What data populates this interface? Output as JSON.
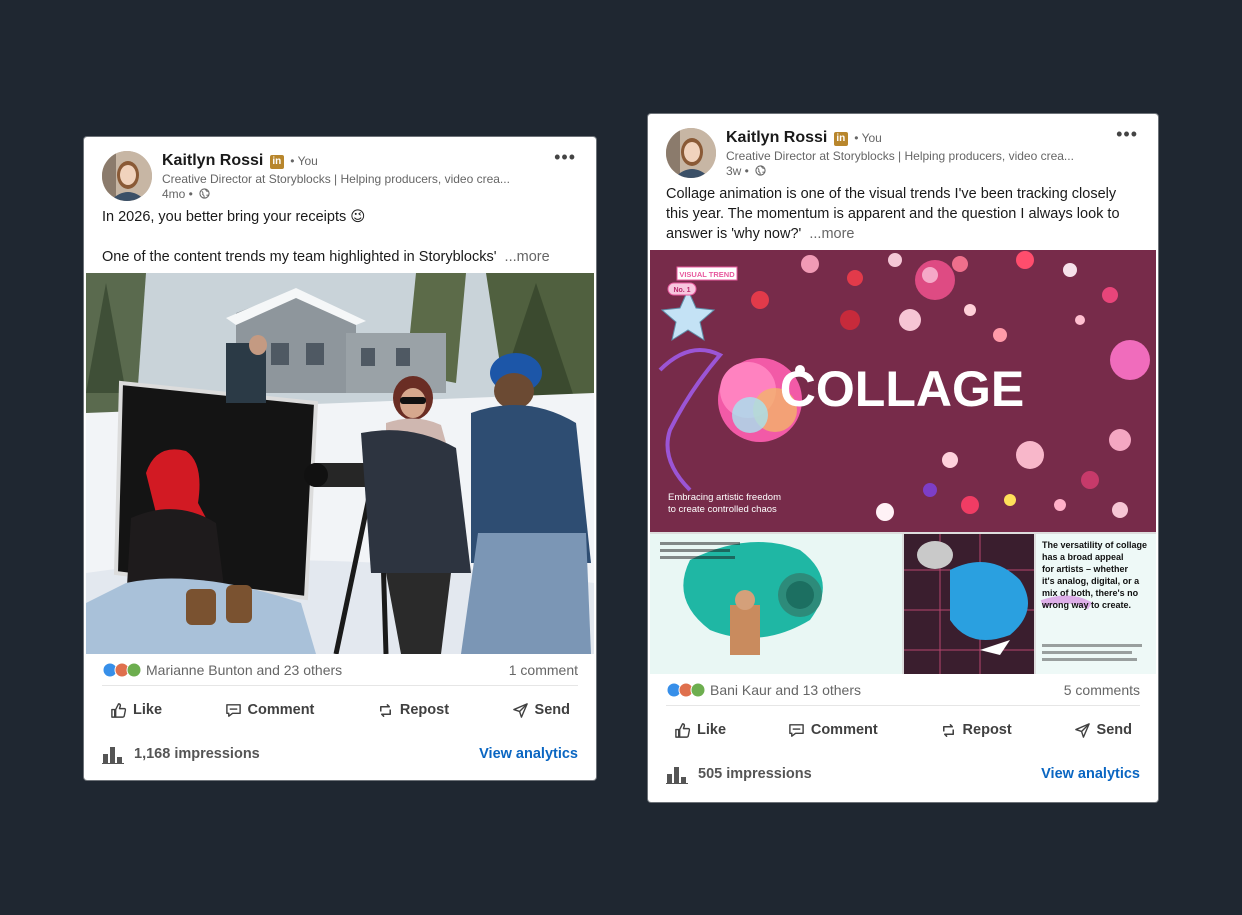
{
  "posts": [
    {
      "author": "Kaitlyn Rossi",
      "badge": "in",
      "you_label": "• You",
      "headline": "Creative Director at Storyblocks | Helping producers, video crea...",
      "time": "4mo •",
      "text_line1": "In 2026, you better bring your receipts 😉",
      "text_line2": "One of the content trends my team highlighted in Storyblocks'",
      "see_more": "...more",
      "reactors": "Marianne Bunton and 23 others",
      "comments": "1 comment",
      "actions": {
        "like": "Like",
        "comment": "Comment",
        "repost": "Repost",
        "send": "Send"
      },
      "impressions": "1,168 impressions",
      "view_analytics": "View analytics"
    },
    {
      "author": "Kaitlyn Rossi",
      "badge": "in",
      "you_label": "• You",
      "headline": "Creative Director at Storyblocks | Helping producers, video crea...",
      "time": "3w •",
      "text_line1": "Collage animation is one of the visual trends I've been tracking closely",
      "text_line2": "this year. The momentum is apparent and the question I always look to",
      "text_line3": "answer is 'why now?'",
      "see_more": "...more",
      "image": {
        "tag": "VISUAL TREND",
        "number": "No. 1",
        "title": "COLLAGE",
        "tagline_1": "Embracing artistic freedom",
        "tagline_2": "to create controlled chaos",
        "panel_1": "The versatility of collage",
        "panel_2": "has a broad appeal",
        "panel_3": "for artists – whether",
        "panel_4": "it's analog, digital, or a",
        "panel_5": "mix of both, there's no",
        "panel_6": "wrong way to create."
      },
      "reactors": "Bani Kaur and 13 others",
      "comments": "5 comments",
      "actions": {
        "like": "Like",
        "comment": "Comment",
        "repost": "Repost",
        "send": "Send"
      },
      "impressions": "505 impressions",
      "view_analytics": "View analytics"
    }
  ],
  "colors": {
    "background": "#1f2731",
    "link": "#0a66c2",
    "badge": "#b8862c",
    "collage_bg": "#7a2a4a",
    "teal": "#2ec4b6"
  }
}
